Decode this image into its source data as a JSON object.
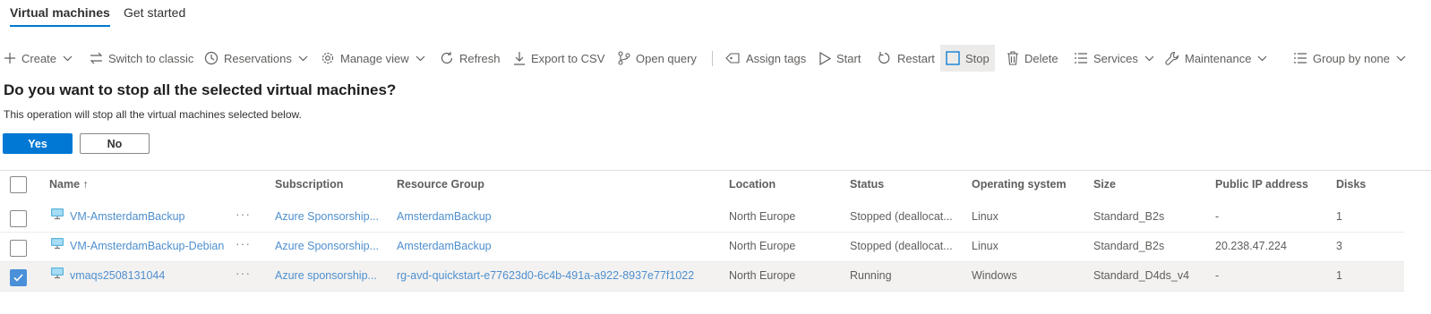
{
  "tabs": [
    {
      "label": "Virtual machines",
      "active": true
    },
    {
      "label": "Get started",
      "active": false
    }
  ],
  "toolbar": {
    "create": "Create",
    "switch_classic": "Switch to classic",
    "reservations": "Reservations",
    "manage_view": "Manage view",
    "refresh": "Refresh",
    "export_csv": "Export to CSV",
    "open_query": "Open query",
    "assign_tags": "Assign tags",
    "start": "Start",
    "restart": "Restart",
    "stop": "Stop",
    "delete": "Delete",
    "services": "Services",
    "maintenance": "Maintenance",
    "group_by": "Group by none"
  },
  "confirm": {
    "title": "Do you want to stop all the selected virtual machines?",
    "message": "This operation will stop all the virtual machines selected below.",
    "yes": "Yes",
    "no": "No"
  },
  "columns": {
    "name": "Name ↑",
    "subscription": "Subscription",
    "resource_group": "Resource Group",
    "location": "Location",
    "status": "Status",
    "os": "Operating system",
    "size": "Size",
    "public_ip": "Public IP address",
    "disks": "Disks"
  },
  "rows": [
    {
      "name": "VM-AmsterdamBackup",
      "more": "···",
      "subscription": "Azure Sponsorship...",
      "resource_group": "AmsterdamBackup",
      "location": "North Europe",
      "status": "Stopped (deallocat...",
      "os": "Linux",
      "size": "Standard_B2s",
      "public_ip": "-",
      "disks": "1",
      "selected": false
    },
    {
      "name": "VM-AmsterdamBackup-Debian",
      "more": "···",
      "subscription": "Azure Sponsorship...",
      "resource_group": "AmsterdamBackup",
      "location": "North Europe",
      "status": "Stopped (deallocat...",
      "os": "Linux",
      "size": "Standard_B2s",
      "public_ip": "20.238.47.224",
      "disks": "3",
      "selected": false
    },
    {
      "name": "vmaqs2508131044",
      "more": "···",
      "subscription": "Azure sponsorship...",
      "resource_group": "rg-avd-quickstart-e77623d0-6c4b-491a-a922-8937e77f1022",
      "location": "North Europe",
      "status": "Running",
      "os": "Windows",
      "size": "Standard_D4ds_v4",
      "public_ip": "-",
      "disks": "1",
      "selected": true
    }
  ],
  "colors": {
    "accent": "#0078d4",
    "link": "#4f8fce",
    "text": "#323130",
    "muted": "#605e5c"
  }
}
